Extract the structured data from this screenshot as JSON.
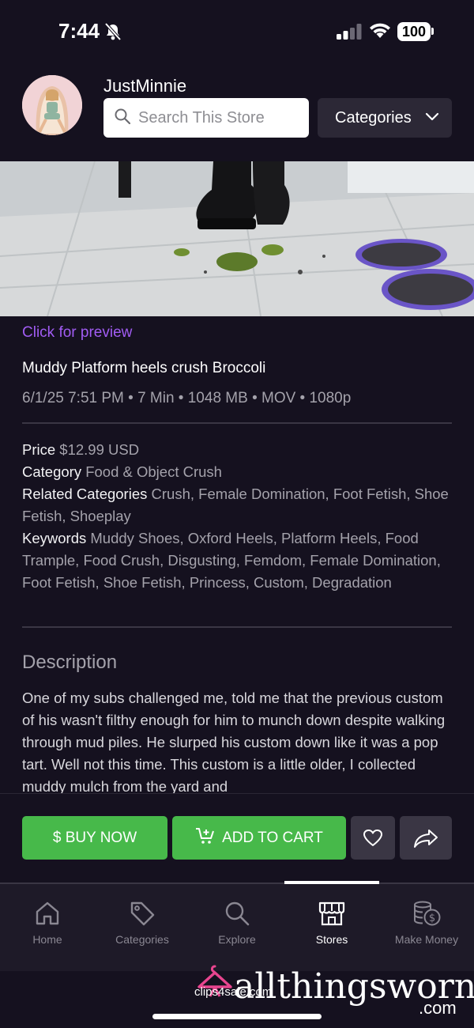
{
  "status_bar": {
    "time": "7:44",
    "battery": "100"
  },
  "store": {
    "name": "JustMinnie",
    "search_placeholder": "Search This Store",
    "categories_label": "Categories"
  },
  "clip": {
    "preview_link": "Click for preview",
    "title": "Muddy Platform heels crush Broccoli",
    "meta": "6/1/25 7:51 PM • 7 Min • 1048 MB • MOV • 1080p",
    "price_label": "Price",
    "price_value": "$12.99 USD",
    "category_label": "Category",
    "category_value": "Food & Object Crush",
    "related_label": "Related Categories",
    "related_value": "Crush, Female Domination, Foot Fetish, Shoe Fetish, Shoeplay",
    "keywords_label": "Keywords",
    "keywords_value": "Muddy Shoes, Oxford Heels, Platform Heels, Food Trample, Food Crush, Disgusting, Femdom, Female Domination, Foot Fetish, Shoe Fetish, Princess, Custom, Degradation",
    "description_title": "Description",
    "description_body": "One of my subs challenged me, told me that the previous custom of his wasn't filthy enough for him to munch down despite walking through mud piles. He slurped his custom down like it was a pop tart. Well not this time. This custom is a little older, I collected muddy mulch from the yard and"
  },
  "actions": {
    "buy_now": "$ BUY NOW",
    "add_to_cart": "ADD TO CART"
  },
  "tabs": [
    {
      "label": "Home",
      "icon": "home-icon"
    },
    {
      "label": "Categories",
      "icon": "tag-icon"
    },
    {
      "label": "Explore",
      "icon": "search-icon"
    },
    {
      "label": "Stores",
      "icon": "store-icon"
    },
    {
      "label": "Make Money",
      "icon": "coins-icon"
    }
  ],
  "active_tab": "Stores",
  "footer": {
    "site": "clips4sale.com",
    "watermark": "allthingsworn",
    "watermark_suffix": ".com"
  },
  "colors": {
    "background": "#15111f",
    "accent_purple": "#a15cf3",
    "buy_green": "#47b94a",
    "muted_text": "#a4a2ab"
  }
}
